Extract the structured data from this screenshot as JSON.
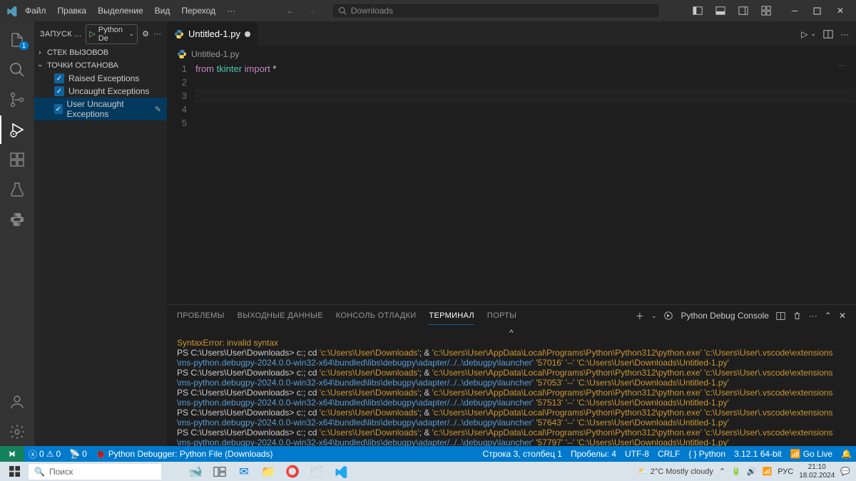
{
  "titlebar": {
    "menu": [
      "Файл",
      "Правка",
      "Выделение",
      "Вид",
      "Переход",
      "···"
    ],
    "search_placeholder": "Downloads"
  },
  "activity_badge": "1",
  "sidebar": {
    "title": "ЗАПУСК ...",
    "config": "Python De",
    "sections": {
      "callstack": "СТЕК ВЫЗОВОВ",
      "breakpoints": "ТОЧКИ ОСТАНОВА"
    },
    "breakpoints": [
      {
        "label": "Raised Exceptions",
        "checked": true,
        "selected": false
      },
      {
        "label": "Uncaught Exceptions",
        "checked": true,
        "selected": false
      },
      {
        "label": "User Uncaught Exceptions",
        "checked": true,
        "selected": true
      }
    ]
  },
  "editor": {
    "tab": "Untitled-1.py",
    "breadcrumb": "Untitled-1.py",
    "line1": {
      "from": "from",
      "mod": "tkinter",
      "import": "import",
      "star": "*"
    },
    "gutter": [
      "1",
      "2",
      "3",
      "4",
      "5"
    ],
    "minimap": "---"
  },
  "panel": {
    "tabs": [
      "ПРОБЛЕМЫ",
      "ВЫХОДНЫЕ ДАННЫЕ",
      "КОНСОЛЬ ОТЛАДКИ",
      "ТЕРМИНАЛ",
      "ПОРТЫ"
    ],
    "shell_label": "Python Debug Console",
    "terminal": {
      "caret": "^",
      "err": "SyntaxError: invalid syntax",
      "ps": "PS C:\\Users\\User\\Downloads> ",
      "cmd_pre": " c:; cd ",
      "s1": "'c:\\Users\\User\\Downloads'",
      "amp": "; & ",
      "s2": "'c:\\Users\\User\\AppData\\Local\\Programs\\Python\\Python312\\python.exe'",
      "s3": "'c:\\Users\\User\\.vscode\\extensions",
      "s3b": "\\ms-python.debugpy-2024.0.0-win32-x64\\bundled\\libs\\debugpy\\adapter/../..\\debugpy\\launcher'",
      "ports": [
        "'57016'",
        "'57053'",
        "'57513'",
        "'57643'",
        "'57797'"
      ],
      "dd": "'--'",
      "s4": "'C:\\Users\\User\\Downloads\\Untitled-1.py'"
    }
  },
  "status": {
    "errors": "0",
    "warnings": "0",
    "ports": "0",
    "debugger": "Python Debugger: Python File (Downloads)",
    "pos": "Строка 3, столбец 1",
    "spaces": "Пробелы: 4",
    "enc": "UTF-8",
    "eol": "CRLF",
    "lang": "Python",
    "py": "3.12.1 64-bit",
    "golive": "Go Live"
  },
  "taskbar": {
    "search": "Поиск",
    "weather": "2°C  Mostly cloudy",
    "lang": "РУС",
    "time": "21:10",
    "date": "18.02.2024"
  }
}
